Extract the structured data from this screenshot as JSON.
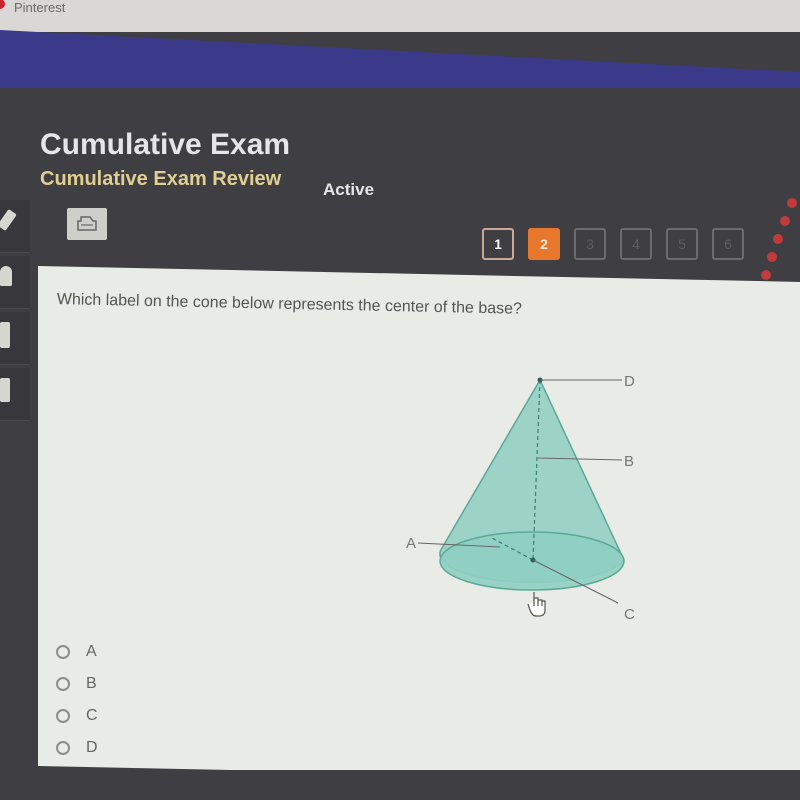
{
  "browser": {
    "tab_title": "Pinterest"
  },
  "header": {
    "title": "Cumulative Exam",
    "subtitle": "Cumulative Exam Review",
    "status": "Active"
  },
  "toolbar": {
    "print_icon": "printer-icon"
  },
  "sidebar": {
    "tools": [
      {
        "icon": "pencil-icon"
      },
      {
        "icon": "headphones-icon"
      },
      {
        "icon": "calculator-icon"
      },
      {
        "icon": "reference-sheet-icon"
      }
    ]
  },
  "pager": {
    "pages": [
      {
        "label": "1",
        "state": "visited"
      },
      {
        "label": "2",
        "state": "current"
      },
      {
        "label": "3",
        "state": "unvisited"
      },
      {
        "label": "4",
        "state": "unvisited"
      },
      {
        "label": "5",
        "state": "unvisited"
      },
      {
        "label": "6",
        "state": "unvisited"
      }
    ]
  },
  "question": {
    "text": "Which label on the cone below represents the center of the base?",
    "diagram": {
      "labels": {
        "A": "A",
        "B": "B",
        "C": "C",
        "D": "D"
      }
    },
    "options": [
      {
        "label": "A"
      },
      {
        "label": "B"
      },
      {
        "label": "C"
      },
      {
        "label": "D"
      }
    ]
  },
  "colors": {
    "accent": "#e8772e",
    "subtitle": "#e0cf92",
    "nav_band": "#3b3a8a",
    "cone_fill": "#8fcfc1",
    "cone_stroke": "#5aa898"
  }
}
